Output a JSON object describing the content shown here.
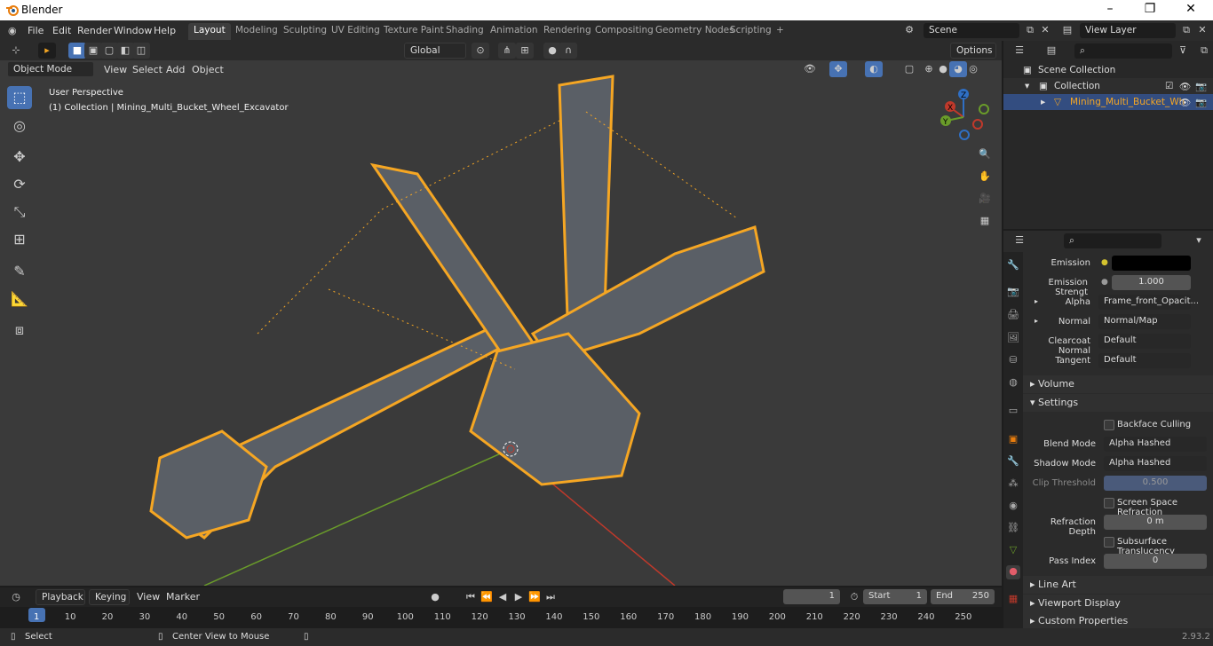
{
  "window": {
    "title": "Blender",
    "minimize": "–",
    "maximize": "❐",
    "close": "✕"
  },
  "menu": {
    "file": "File",
    "edit": "Edit",
    "render": "Render",
    "window": "Window",
    "help": "Help"
  },
  "workspaces": [
    "Layout",
    "Modeling",
    "Sculpting",
    "UV Editing",
    "Texture Paint",
    "Shading",
    "Animation",
    "Rendering",
    "Compositing",
    "Geometry Nodes",
    "Scripting"
  ],
  "add_workspace": "+",
  "scene": {
    "value": "Scene"
  },
  "view_layer": {
    "value": "View Layer"
  },
  "viewport": {
    "transform_orientation": "Global",
    "options": "Options",
    "mode": "Object Mode",
    "menus": {
      "view": "View",
      "select": "Select",
      "add": "Add",
      "object": "Object"
    },
    "info_line1": "User Perspective",
    "info_line2": "(1) Collection | Mining_Multi_Bucket_Wheel_Excavator",
    "gizmo": {
      "x": "X",
      "y": "Y",
      "z": "Z"
    }
  },
  "outliner": {
    "scene_collection": "Scene Collection",
    "collection": "Collection",
    "object": "Mining_Multi_Bucket_Wh"
  },
  "properties": {
    "emission_label": "Emission",
    "emission_strength_label": "Emission Strengt",
    "emission_strength_value": "1.000",
    "alpha_label": "Alpha",
    "alpha_value": "Frame_front_Opacit...",
    "normal_label": "Normal",
    "normal_value": "Normal/Map",
    "clearcoat_label": "Clearcoat Normal",
    "clearcoat_value": "Default",
    "tangent_label": "Tangent",
    "tangent_value": "Default",
    "volume": "Volume",
    "settings": "Settings",
    "backface": "Backface Culling",
    "blend_mode_label": "Blend Mode",
    "blend_mode_value": "Alpha Hashed",
    "shadow_mode_label": "Shadow Mode",
    "shadow_mode_value": "Alpha Hashed",
    "clip_label": "Clip Threshold",
    "clip_value": "0.500",
    "ssr": "Screen Space Refraction",
    "refraction_depth_label": "Refraction Depth",
    "refraction_depth_value": "0 m",
    "subsurface": "Subsurface Translucency",
    "pass_index_label": "Pass Index",
    "pass_index_value": "0",
    "line_art": "Line Art",
    "viewport_display": "Viewport Display",
    "custom_properties": "Custom Properties"
  },
  "timeline": {
    "playback": "Playback",
    "keying": "Keying",
    "view": "View",
    "marker": "Marker",
    "current_frame": "1",
    "start_label": "Start",
    "start_value": "1",
    "end_label": "End",
    "end_value": "250",
    "ticks": [
      "1",
      "10",
      "20",
      "30",
      "40",
      "50",
      "60",
      "70",
      "80",
      "90",
      "100",
      "110",
      "120",
      "130",
      "140",
      "150",
      "160",
      "170",
      "180",
      "190",
      "200",
      "210",
      "220",
      "230",
      "240",
      "250"
    ]
  },
  "status": {
    "select": "Select",
    "center_view": "Center View to Mouse",
    "version": "2.93.2"
  },
  "colors": {
    "accent": "#4772b3",
    "selection_outline": "#f5a623",
    "x_axis": "#c0392b",
    "y_axis": "#6a9c2a"
  }
}
